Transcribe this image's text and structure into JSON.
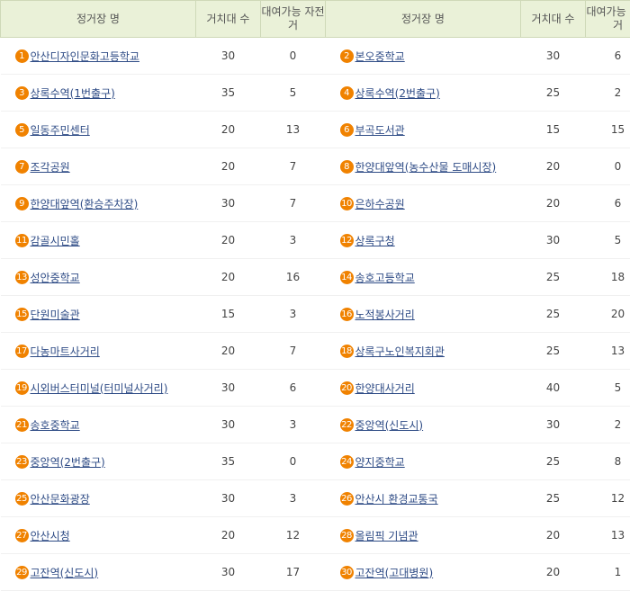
{
  "headers": {
    "station_name": "정거장 명",
    "rack_count": "거치대 수",
    "available_bikes": "대여가능 자전거"
  },
  "marker_color": "#f08200",
  "rows": [
    {
      "left": {
        "no": "1",
        "name": "안산디자인문화고등학교",
        "racks": "30",
        "bikes": "0"
      },
      "right": {
        "no": "2",
        "name": "본오중학교",
        "racks": "30",
        "bikes": "6"
      }
    },
    {
      "left": {
        "no": "3",
        "name": "상록수역(1번출구)",
        "racks": "35",
        "bikes": "5"
      },
      "right": {
        "no": "4",
        "name": "상록수역(2번출구)",
        "racks": "25",
        "bikes": "2"
      }
    },
    {
      "left": {
        "no": "5",
        "name": "일동주민센터",
        "racks": "20",
        "bikes": "13"
      },
      "right": {
        "no": "6",
        "name": "부곡도서관",
        "racks": "15",
        "bikes": "15"
      }
    },
    {
      "left": {
        "no": "7",
        "name": "조각공원",
        "racks": "20",
        "bikes": "7"
      },
      "right": {
        "no": "8",
        "name": "한양대앞역(농수산물 도매시장)",
        "racks": "20",
        "bikes": "0"
      }
    },
    {
      "left": {
        "no": "9",
        "name": "한양대앞역(환승주차장)",
        "racks": "30",
        "bikes": "7"
      },
      "right": {
        "no": "10",
        "name": "은하수공원",
        "racks": "20",
        "bikes": "6"
      }
    },
    {
      "left": {
        "no": "11",
        "name": "감골시민홀",
        "racks": "20",
        "bikes": "3"
      },
      "right": {
        "no": "12",
        "name": "상록구청",
        "racks": "30",
        "bikes": "5"
      }
    },
    {
      "left": {
        "no": "13",
        "name": "성안중학교",
        "racks": "20",
        "bikes": "16"
      },
      "right": {
        "no": "14",
        "name": "송호고등학교",
        "racks": "25",
        "bikes": "18"
      }
    },
    {
      "left": {
        "no": "15",
        "name": "단원미술관",
        "racks": "15",
        "bikes": "3"
      },
      "right": {
        "no": "16",
        "name": "노적봉사거리",
        "racks": "25",
        "bikes": "20"
      }
    },
    {
      "left": {
        "no": "17",
        "name": "다농마트사거리",
        "racks": "20",
        "bikes": "7"
      },
      "right": {
        "no": "18",
        "name": "상록구노인복지회관",
        "racks": "25",
        "bikes": "13"
      }
    },
    {
      "left": {
        "no": "19",
        "name": "시외버스터미널(터미널사거리)",
        "racks": "30",
        "bikes": "6"
      },
      "right": {
        "no": "20",
        "name": "한양대사거리",
        "racks": "40",
        "bikes": "5"
      }
    },
    {
      "left": {
        "no": "21",
        "name": "송호중학교",
        "racks": "30",
        "bikes": "3"
      },
      "right": {
        "no": "22",
        "name": "중앙역(신도시)",
        "racks": "30",
        "bikes": "2"
      }
    },
    {
      "left": {
        "no": "23",
        "name": "중앙역(2번출구)",
        "racks": "35",
        "bikes": "0"
      },
      "right": {
        "no": "24",
        "name": "양지중학교",
        "racks": "25",
        "bikes": "8"
      }
    },
    {
      "left": {
        "no": "25",
        "name": "안산문화광장",
        "racks": "30",
        "bikes": "3"
      },
      "right": {
        "no": "26",
        "name": "안산시 환경교통국",
        "racks": "25",
        "bikes": "12"
      }
    },
    {
      "left": {
        "no": "27",
        "name": "안산시청",
        "racks": "20",
        "bikes": "12"
      },
      "right": {
        "no": "28",
        "name": "올림픽 기념관",
        "racks": "20",
        "bikes": "13"
      }
    },
    {
      "left": {
        "no": "29",
        "name": "고잔역(신도시)",
        "racks": "30",
        "bikes": "17"
      },
      "right": {
        "no": "30",
        "name": "고잔역(고대병원)",
        "racks": "20",
        "bikes": "1"
      }
    }
  ]
}
